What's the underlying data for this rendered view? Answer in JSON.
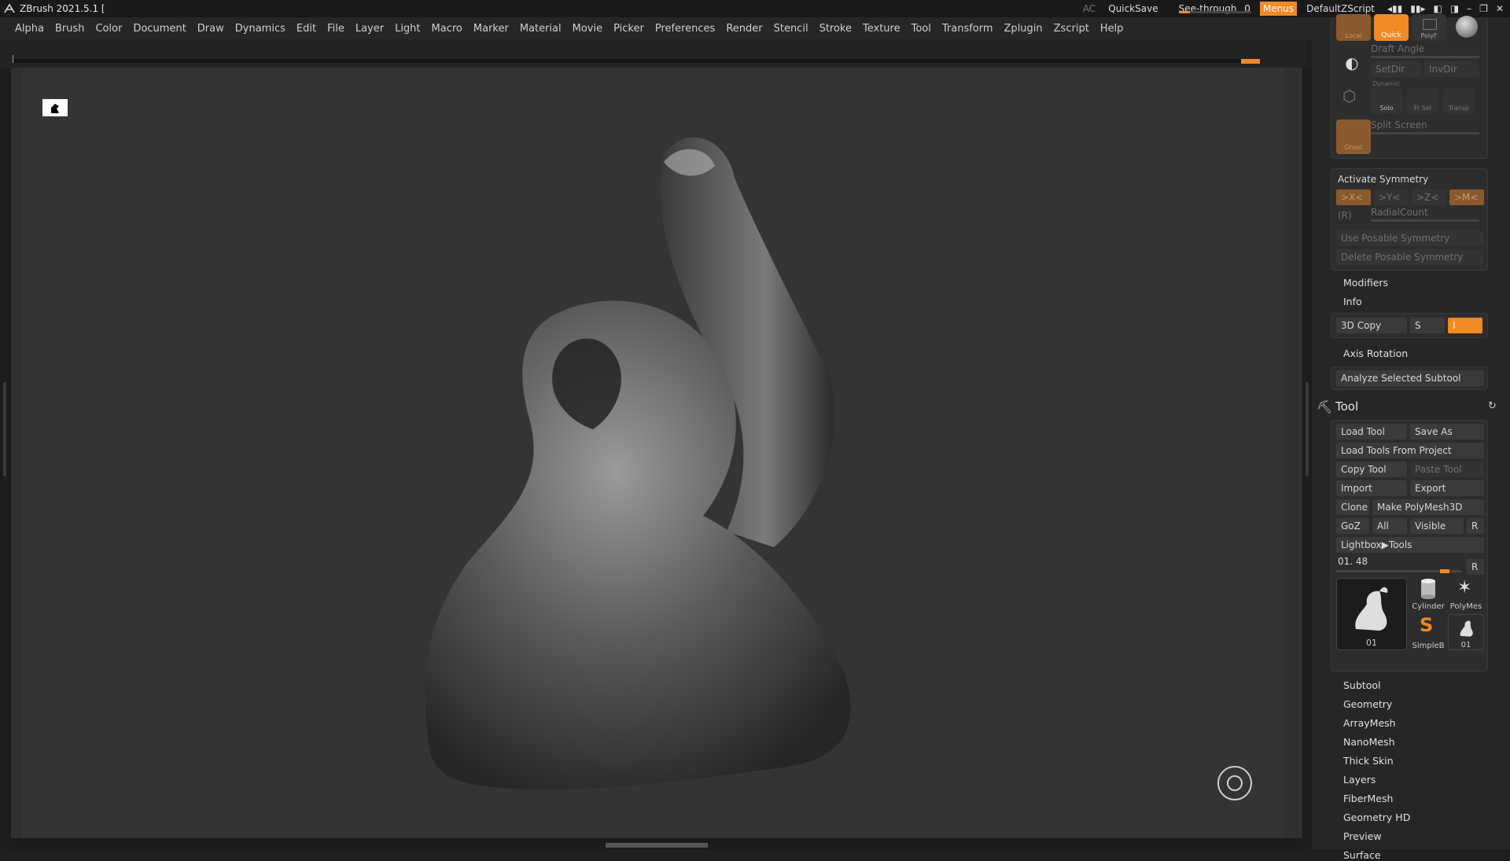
{
  "app": {
    "title": "ZBrush 2021.5.1 ["
  },
  "titlebar": {
    "ac": "AC",
    "quicksave": "QuickSave",
    "see_through": "See-through",
    "see_through_value": "0",
    "see_through_level": 0.15,
    "menus": "Menus",
    "script": "DefaultZScript"
  },
  "menubar": [
    "Alpha",
    "Brush",
    "Color",
    "Document",
    "Draw",
    "Dynamics",
    "Edit",
    "File",
    "Layer",
    "Light",
    "Macro",
    "Marker",
    "Material",
    "Movie",
    "Picker",
    "Preferences",
    "Render",
    "Stencil",
    "Stroke",
    "Texture",
    "Tool",
    "Transform",
    "Zplugin",
    "Zscript",
    "Help"
  ],
  "tray": {
    "top_icons": {
      "local": "Local",
      "quick": "Quick",
      "polyf": "PolyF"
    },
    "draft_angle": "Draft Angle",
    "setdir": "SetDir",
    "invdir": "InvDir",
    "dynamic": "Dynamic",
    "solo": "Solo",
    "frsel": "Fr Sel",
    "transp": "Transp",
    "split_screen": "Split Screen",
    "ghost": "Ghost",
    "activate_symmetry": "Activate Symmetry",
    "sym_x": ">X<",
    "sym_y": ">Y<",
    "sym_z": ">Z<",
    "sym_m": ">M<",
    "sym_r": "(R)",
    "radial_count": "RadialCount",
    "use_posable": "Use Posable Symmetry",
    "delete_posable": "Delete Posable Symmetry",
    "modifiers": "Modifiers",
    "info": "Info",
    "copy3d": "3D Copy",
    "copy3d_s": "S",
    "copy3d_i": "I",
    "axis_rotation": "Axis Rotation",
    "analyze": "Analyze Selected Subtool",
    "tool_title": "Tool",
    "load_tool": "Load Tool",
    "save_as": "Save As",
    "load_from_project": "Load Tools From Project",
    "copy_tool": "Copy Tool",
    "paste_tool": "Paste Tool",
    "import": "Import",
    "export": "Export",
    "clone": "Clone",
    "make_polymesh": "Make PolyMesh3D",
    "goz": "GoZ",
    "all": "All",
    "visible": "Visible",
    "r": "R",
    "lightbox_tools": "Lightbox▶Tools",
    "tool_slider_label": "01. 48",
    "tool_slider_level": 0.9,
    "tool_r": "R",
    "thumb_main": "01",
    "thumb_cylinder": "Cylinder",
    "thumb_polymesh": "PolyMes",
    "thumb_simpleb": "SimpleB",
    "thumb_01": "01",
    "sections": [
      "Subtool",
      "Geometry",
      "ArrayMesh",
      "NanoMesh",
      "Thick Skin",
      "Layers",
      "FiberMesh",
      "Geometry HD",
      "Preview",
      "Surface"
    ]
  },
  "colors": {
    "accent": "#f08a24",
    "background": "#303030",
    "panel": "#262626"
  }
}
